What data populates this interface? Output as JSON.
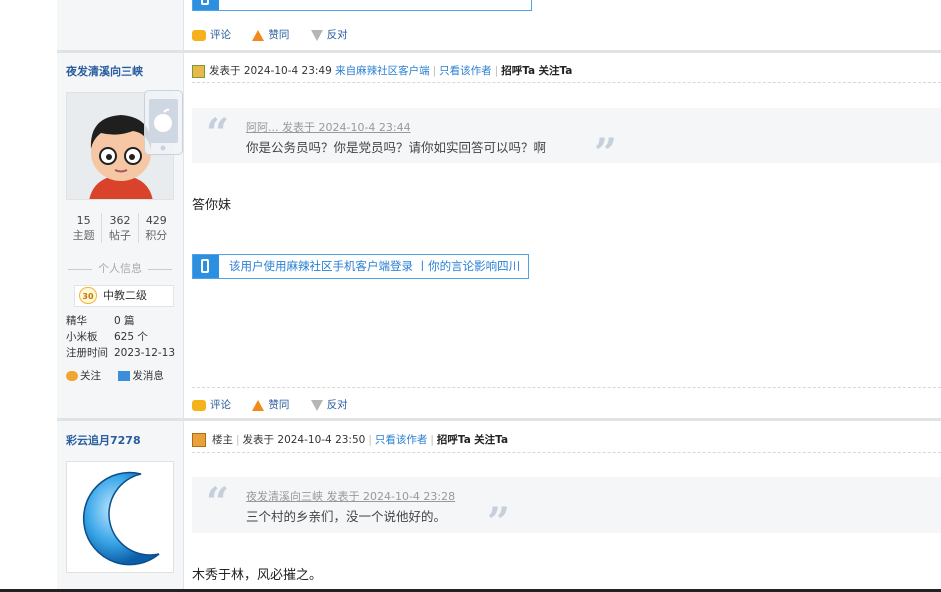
{
  "top_actions": {
    "comment": "评论",
    "like": "赞同",
    "oppose": "反对"
  },
  "post1": {
    "author": "夜发清溪向三峡",
    "stats": [
      {
        "value": "15",
        "label": "主题"
      },
      {
        "value": "362",
        "label": "帖子"
      },
      {
        "value": "429",
        "label": "积分"
      }
    ],
    "section_title": "个人信息",
    "level_num": "30",
    "level": "中教二级",
    "info": [
      {
        "k": "精华",
        "v": "0 篇"
      },
      {
        "k": "小米板",
        "v": "625 个"
      },
      {
        "k": "注册时间",
        "v": "2023-12-13"
      }
    ],
    "follow": "关注",
    "message": "发消息",
    "posted": "发表于 2024-10-4 23:49",
    "client_from": "来自麻辣社区客户端",
    "only_author": "只看该作者",
    "greet": "招呼Ta",
    "follow_ta": "关注Ta",
    "quote_head": "阿阿... 发表于 2024-10-4 23:44",
    "quote_text": "你是公务员吗？你是党员吗？请你如实回答可以吗？啊",
    "body": "答你妹",
    "client_box": "该用户使用麻辣社区手机客户端登录 丨你的言论影响四川",
    "actions": {
      "comment": "评论",
      "like": "赞同",
      "oppose": "反对"
    }
  },
  "post2": {
    "author": "彩云追月7278",
    "louzhu": "楼主",
    "posted": "发表于 2024-10-4 23:50",
    "only_author": "只看该作者",
    "greet": "招呼Ta",
    "follow_ta": "关注Ta",
    "quote_head": "夜发清溪向三峡 发表于 2024-10-4 23:28",
    "quote_text": "三个村的乡亲们，没一个说他好的。",
    "body": "木秀于林，风必摧之。"
  },
  "colors": {
    "link_blue": "#2a7fd4",
    "author_blue": "#2a5d9f",
    "panel_bg": "#f4f6f8"
  }
}
